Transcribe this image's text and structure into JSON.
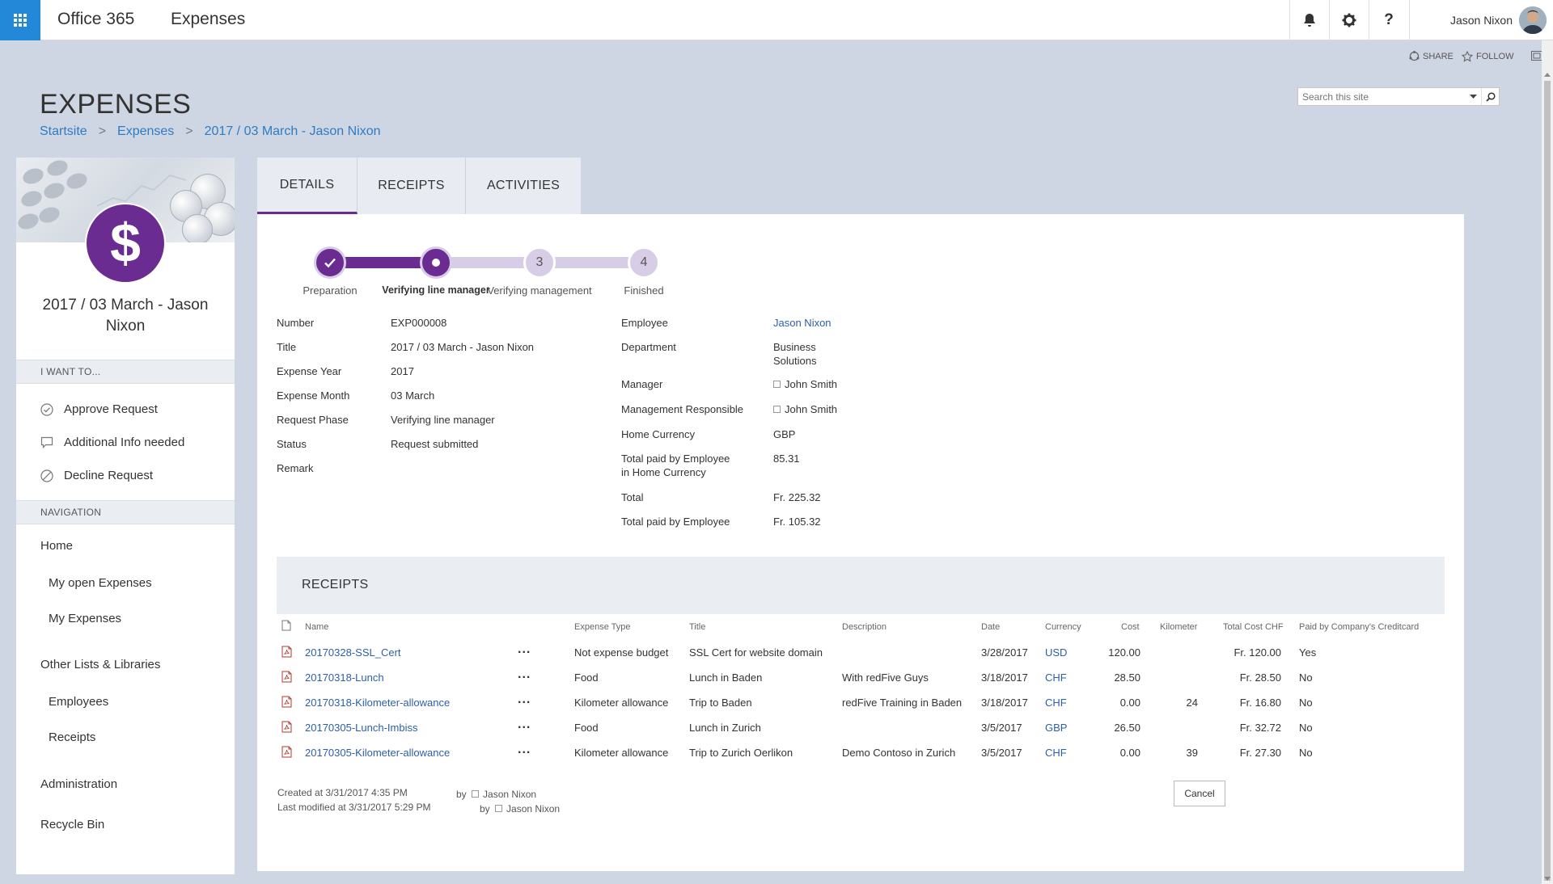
{
  "suite": {
    "brand": "Office 365",
    "app_name": "Expenses",
    "user_name": "Jason Nixon"
  },
  "top_actions": {
    "share": "SHARE",
    "follow": "FOLLOW"
  },
  "header": {
    "title": "EXPENSES",
    "breadcrumb": [
      "Startsite",
      "Expenses",
      "2017 / 03 March - Jason Nixon"
    ],
    "search_placeholder": "Search this site"
  },
  "left": {
    "title": "2017 / 03 March - Jason Nixon",
    "i_want_to": "I WANT TO...",
    "actions": [
      "Approve Request",
      "Additional Info needed",
      "Decline Request"
    ],
    "navigation": "NAVIGATION",
    "nav": [
      "Home",
      "My open Expenses",
      "My Expenses",
      "Other Lists & Libraries",
      "Employees",
      "Receipts",
      "Administration",
      "Recycle Bin"
    ]
  },
  "tabs": [
    "DETAILS",
    "RECEIPTS",
    "ACTIVITIES"
  ],
  "stepper": {
    "steps": [
      {
        "number": "",
        "label": "Preparation",
        "state": "done"
      },
      {
        "number": "",
        "label": "Verifying line manager",
        "state": "current"
      },
      {
        "number": "3",
        "label": "Verifying management",
        "state": "pending"
      },
      {
        "number": "4",
        "label": "Finished",
        "state": "pending"
      }
    ],
    "progress": 0.333
  },
  "details_left": [
    {
      "label": "Number",
      "value": "EXP000008"
    },
    {
      "label": "Title",
      "value": "2017 / 03 March - Jason Nixon"
    },
    {
      "label": "Expense Year",
      "value": "2017"
    },
    {
      "label": "Expense Month",
      "value": "03 March"
    },
    {
      "label": "Request Phase",
      "value": "Verifying line manager"
    },
    {
      "label": "Status",
      "value": "Request submitted"
    },
    {
      "label": "Remark",
      "value": ""
    }
  ],
  "details_right": {
    "employee_label": "Employee",
    "employee": "Jason Nixon",
    "department_label": "Department",
    "department_1": "Business",
    "department_2": "Solutions",
    "manager_label": "Manager",
    "manager": "John Smith",
    "mgmt_label": "Management Responsible",
    "mgmt": "John Smith",
    "currency_label": "Home Currency",
    "currency": "GBP",
    "paid_home_label_1": "Total paid by Employee",
    "paid_home_label_2": "in Home Currency",
    "paid_home": "85.31",
    "total_label": "Total",
    "total": "Fr. 225.32",
    "paid_label": "Total paid by Employee",
    "paid": "Fr. 105.32"
  },
  "receipts": {
    "title": "RECEIPTS",
    "columns": [
      "Name",
      "Expense Type",
      "Title",
      "Description",
      "Date",
      "Currency",
      "Cost",
      "Kilometer",
      "Total Cost CHF",
      "Paid by Company's Creditcard"
    ],
    "rows": [
      {
        "name": "20170328-SSL_Cert",
        "type": "Not expense budget",
        "title": "SSL Cert for website domain",
        "description": "",
        "date": "3/28/2017",
        "currency": "USD",
        "cost": "120.00",
        "km": "",
        "total": "Fr. 120.00",
        "paid": "Yes"
      },
      {
        "name": "20170318-Lunch",
        "type": "Food",
        "title": "Lunch in Baden",
        "description": "With redFive Guys",
        "date": "3/18/2017",
        "currency": "CHF",
        "cost": "28.50",
        "km": "",
        "total": "Fr. 28.50",
        "paid": "No"
      },
      {
        "name": "20170318-Kilometer-allowance",
        "type": "Kilometer allowance",
        "title": "Trip to Baden",
        "description": "redFive Training in Baden",
        "date": "3/18/2017",
        "currency": "CHF",
        "cost": "0.00",
        "km": "24",
        "total": "Fr. 16.80",
        "paid": "No"
      },
      {
        "name": "20170305-Lunch-Imbiss",
        "type": "Food",
        "title": "Lunch in Zurich",
        "description": "",
        "date": "3/5/2017",
        "currency": "GBP",
        "cost": "26.50",
        "km": "",
        "total": "Fr. 32.72",
        "paid": "No"
      },
      {
        "name": "20170305-Kilometer-allowance",
        "type": "Kilometer allowance",
        "title": "Trip to Zurich Oerlikon",
        "description": "Demo Contoso in Zurich",
        "date": "3/5/2017",
        "currency": "CHF",
        "cost": "0.00",
        "km": "39",
        "total": "Fr. 27.30",
        "paid": "No"
      }
    ],
    "ellipsis": "..."
  },
  "footer": {
    "created": "Created at 3/31/2017 4:35 PM",
    "modified": "Last modified at 3/31/2017 5:29 PM",
    "by": "by",
    "created_by": "Jason Nixon",
    "modified_by": "Jason Nixon",
    "cancel": "Cancel"
  },
  "colors": {
    "accent": "#6b2c91",
    "accent_light": "#d8cde6",
    "link": "#2d5fa8",
    "waffle": "#2488d8"
  }
}
